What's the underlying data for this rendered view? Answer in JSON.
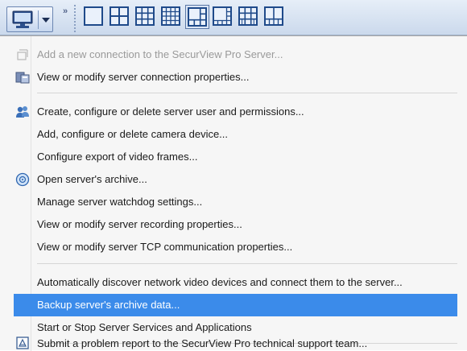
{
  "toolbar": {
    "server_button_icon": "server-monitor-icon",
    "overflow_glyph": "»",
    "layouts": [
      {
        "icon": "layout-1x1-icon"
      },
      {
        "icon": "layout-2x2-icon"
      },
      {
        "icon": "layout-3x3-icon"
      },
      {
        "icon": "layout-4x4-icon"
      },
      {
        "icon": "layout-1plus5-icon",
        "selected": true
      },
      {
        "icon": "layout-1plus7-icon"
      },
      {
        "icon": "layout-3x3-alt-icon"
      },
      {
        "icon": "layout-2plus8-icon"
      }
    ]
  },
  "menu": {
    "items": [
      {
        "label": "Add a new connection to the SecurView Pro Server...",
        "icon": "new-connection-icon",
        "disabled": true
      },
      {
        "label": "View or modify server connection properties...",
        "icon": "connection-properties-icon"
      },
      {
        "label": "Create, configure or delete server user and permissions...",
        "icon": "users-icon"
      },
      {
        "label": "Add, configure or delete camera device..."
      },
      {
        "label": "Configure export of video frames..."
      },
      {
        "label": "Open server's archive...",
        "icon": "archive-icon"
      },
      {
        "label": "Manage server watchdog settings..."
      },
      {
        "label": "View or modify server recording properties..."
      },
      {
        "label": "View or modify server TCP communication properties..."
      },
      {
        "label": "Automatically discover network video devices and connect them to the server..."
      },
      {
        "label": "Backup server's archive data...",
        "highlighted": true
      },
      {
        "label": "Start or Stop Server Services and Applications"
      },
      {
        "label": "Submit a problem report to the SecurView Pro technical support team...",
        "icon": "report-icon"
      }
    ]
  },
  "colors": {
    "highlight": "#3b8bea",
    "toolbar_icon": "#1f4a8a",
    "disabled_text": "#9a9a9a"
  }
}
